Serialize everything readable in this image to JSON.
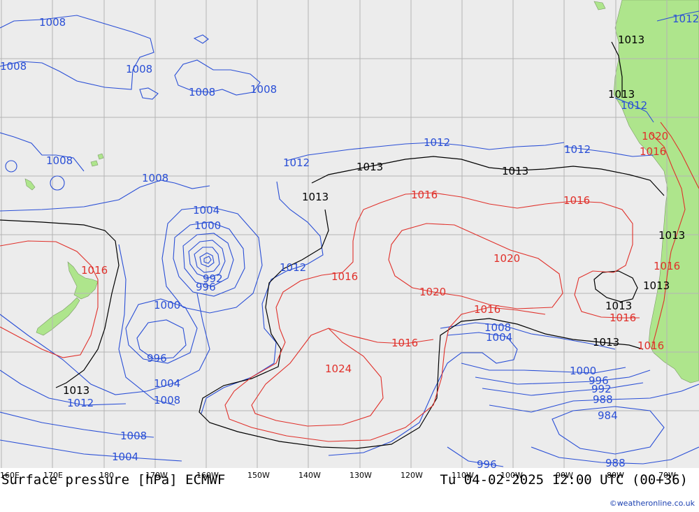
{
  "title_left": "Surface pressure [hPa] ECMWF",
  "title_right": "Tu 04-02-2025 12:00 UTC (00+36)",
  "credit": "©weatheronline.co.uk",
  "colors": {
    "ocean": "#ececec",
    "land": "#aee58c",
    "grid": "#b4b4b4",
    "low": "#2a4fd6",
    "std": "#000000",
    "high": "#e0302a",
    "credit": "#1a3fb0"
  },
  "lon_ticks": [
    "160E",
    "170E",
    "180",
    "170W",
    "160W",
    "150W",
    "140W",
    "130W",
    "120W",
    "110W",
    "100W",
    "90W",
    "80W",
    "70W"
  ],
  "isobar_labels": {
    "l1008a": "1008",
    "l1008b": "1008",
    "l1008c": "1008",
    "l1008d": "1008",
    "l1008e": "1008",
    "l1008f": "1008",
    "l1008g": "1008",
    "l1008h": "1008",
    "l1008i": "1008",
    "l1008j": "1008",
    "l1008k": "1008",
    "l1012a": "1012",
    "l1012b": "1012",
    "l1012c": "1012",
    "l1012d": "1012",
    "l1012e": "1012",
    "l1012f": "1012",
    "l1012g": "1012",
    "l1012h": "1012",
    "l1013a": "1013",
    "l1013b": "1013",
    "l1013c": "1013",
    "l1013d": "1013",
    "l1013e": "1013",
    "l1013f": "1013",
    "l1013g": "1013",
    "l1013h": "1013",
    "l1013i": "1013",
    "l1013j": "1013",
    "l1004a": "1004",
    "l1004b": "1004",
    "l1004c": "1004",
    "l1004d": "1004",
    "l1000a": "1000",
    "l1000b": "1000",
    "l1000c": "1000",
    "l996a": "996",
    "l996b": "996",
    "l996c": "996",
    "l996d": "996",
    "l992a": "992",
    "l992b": "992",
    "l988a": "988",
    "l988b": "988",
    "l984a": "984",
    "l1016a": "1016",
    "l1016b": "1016",
    "l1016c": "1016",
    "l1016d": "1016",
    "l1016e": "1016",
    "l1016f": "1016",
    "l1016g": "1016",
    "l1016h": "1016",
    "l1016i": "1016",
    "l1016j": "1016",
    "l1020a": "1020",
    "l1020b": "1020",
    "l1020c": "1020",
    "l1024a": "1024"
  }
}
